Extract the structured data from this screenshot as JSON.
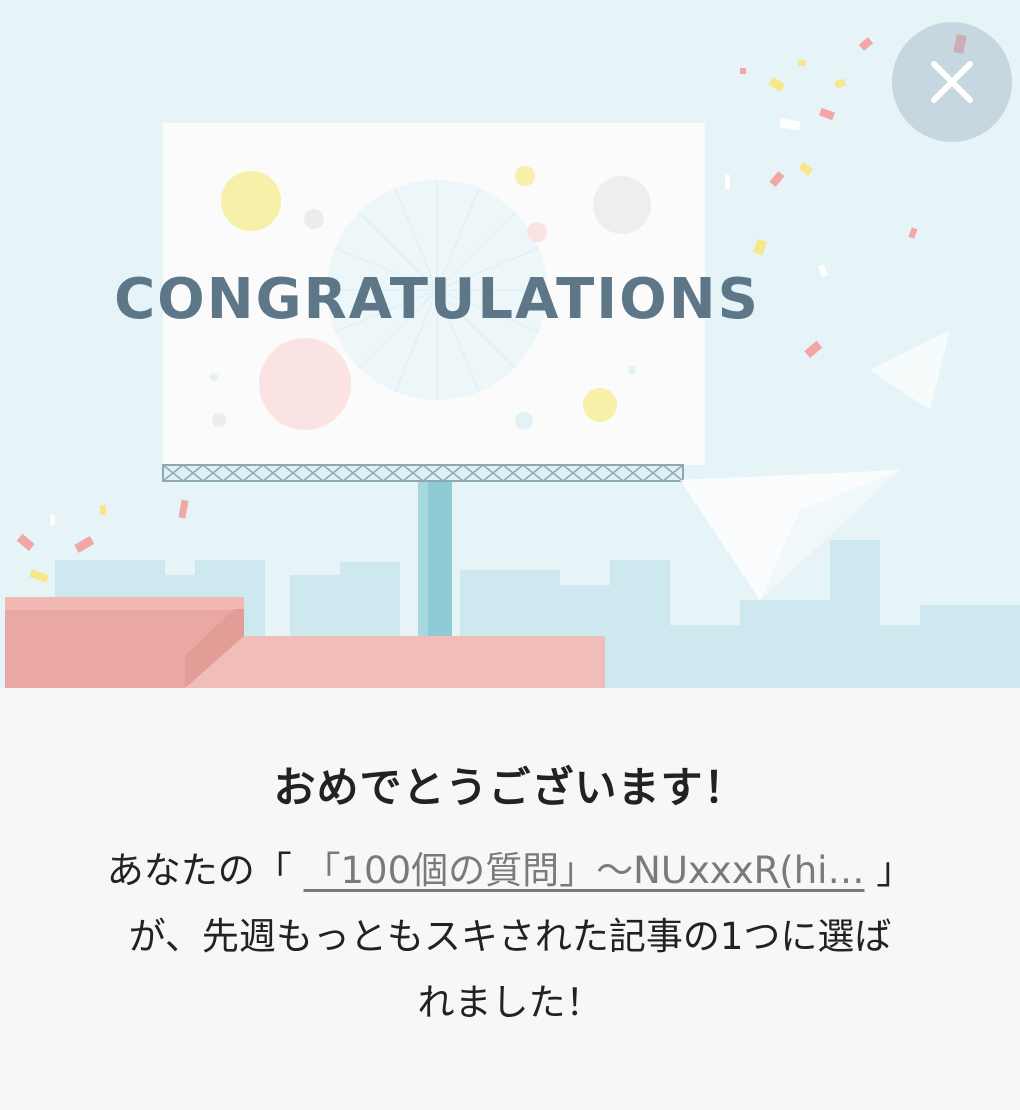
{
  "dialog": {
    "banner": {
      "billboard_text": "CONGRATULATIONS"
    },
    "close_icon": "close-icon",
    "heading": "おめでとうございます！",
    "message": {
      "prefix": "あなたの「 ",
      "article_link": "「100個の質問」〜NUxxxR(hi…",
      "line1_end": " 」",
      "line2": "が、先週もっともスキされた記事の1つに選ば",
      "line3": "れました！"
    }
  }
}
